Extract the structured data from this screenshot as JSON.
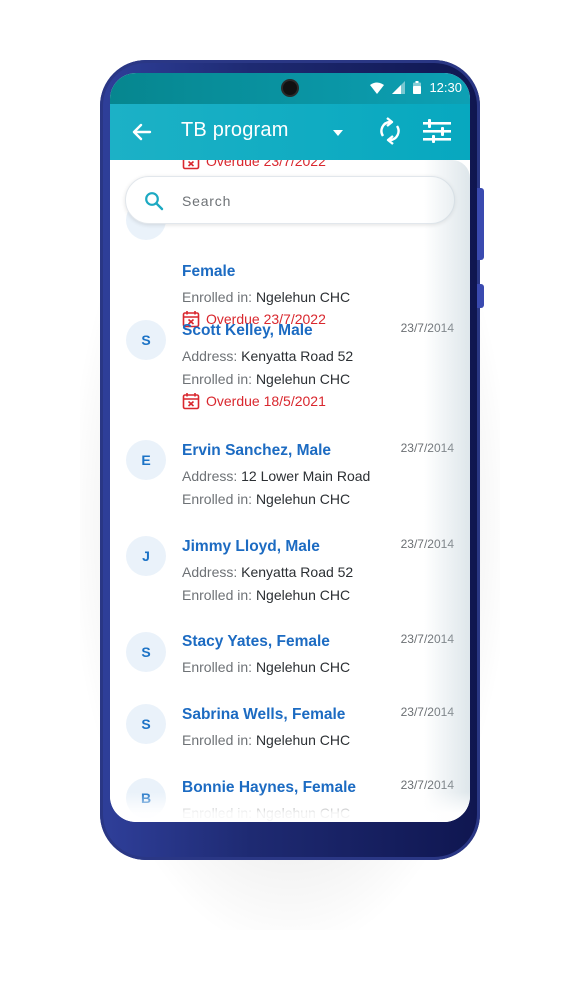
{
  "status_bar": {
    "time": "12:30"
  },
  "app_bar": {
    "title": "TB program"
  },
  "search": {
    "placeholder": "Search"
  },
  "labels": {
    "address": "Address:",
    "enrolled": "Enrolled in:"
  },
  "colors": {
    "accent": "#07a8bf",
    "link": "#1c6bc2",
    "overdue": "#d9272e"
  },
  "list": {
    "partial_top": {
      "overdue": "Overdue 23/7/2022"
    },
    "items": [
      {
        "initial": "",
        "name": "Female",
        "date": "",
        "address": "",
        "enrolled": "Ngelehun CHC",
        "overdue": "Overdue 23/7/2022"
      },
      {
        "initial": "S",
        "name": "Scott Kelley, Male",
        "date": "23/7/2014",
        "address": "Kenyatta Road 52",
        "enrolled": "Ngelehun CHC",
        "overdue": "Overdue 18/5/2021"
      },
      {
        "initial": "E",
        "name": "Ervin Sanchez, Male",
        "date": "23/7/2014",
        "address": "12 Lower Main Road",
        "enrolled": "Ngelehun CHC",
        "overdue": ""
      },
      {
        "initial": "J",
        "name": "Jimmy Lloyd, Male",
        "date": "23/7/2014",
        "address": "Kenyatta Road 52",
        "enrolled": "Ngelehun CHC",
        "overdue": ""
      },
      {
        "initial": "S",
        "name": "Stacy Yates, Female",
        "date": "23/7/2014",
        "address": "",
        "enrolled": "Ngelehun CHC",
        "overdue": ""
      },
      {
        "initial": "S",
        "name": "Sabrina Wells, Female",
        "date": "23/7/2014",
        "address": "",
        "enrolled": "Ngelehun CHC",
        "overdue": ""
      },
      {
        "initial": "B",
        "name": "Bonnie Haynes, Female",
        "date": "23/7/2014",
        "address": "",
        "enrolled": "Ngelehun CHC",
        "overdue": ""
      }
    ]
  }
}
